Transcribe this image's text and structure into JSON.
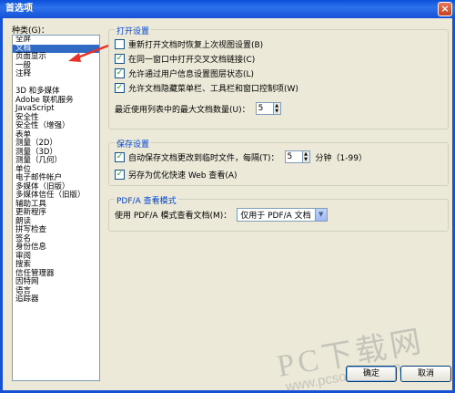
{
  "window": {
    "title": "首选项",
    "close_glyph": "×"
  },
  "categories": {
    "label": "种类(G)：",
    "top_items": [
      "全屏",
      "文档",
      "页面显示",
      "一般",
      "注释"
    ],
    "selected_index": 1,
    "items": [
      "3D 和多媒体",
      "Adobe 联机服务",
      "JavaScript",
      "安全性",
      "安全性（增强）",
      "表单",
      "测量（2D）",
      "测量（3D）",
      "测量（几何）",
      "单位",
      "电子邮件帐户",
      "多媒体（旧版）",
      "多媒体信任（旧版）",
      "辅助工具",
      "更新程序",
      "朗读",
      "拼写检查",
      "签名",
      "身份信息",
      "审阅",
      "搜索",
      "信任管理器",
      "因特网",
      "语言",
      "追踪器"
    ]
  },
  "open_settings": {
    "title": "打开设置",
    "options": [
      {
        "label": "重新打开文档时恢复上次视图设置(B)",
        "checked": false
      },
      {
        "label": "在同一窗口中打开交叉文档链接(C)",
        "checked": true
      },
      {
        "label": "允许通过用户信息设置图层状态(L)",
        "checked": true
      },
      {
        "label": "允许文档隐藏菜单栏、工具栏和窗口控制项(W)",
        "checked": true
      }
    ],
    "max_docs_label": "最近使用列表中的最大文档数量(U)：",
    "max_docs_value": "5"
  },
  "save_settings": {
    "title": "保存设置",
    "autosave_label": "自动保存文档更改到临时文件，每隔(T)：",
    "autosave_checked": true,
    "autosave_value": "5",
    "autosave_unit": "分钟（1-99）",
    "fast_web_label": "另存为优化快速 Web 查看(A)",
    "fast_web_checked": true
  },
  "pdfa": {
    "title": "PDF/A 查看模式",
    "label": "使用 PDF/A 模式查看文档(M)：",
    "selected": "仅用于 PDF/A 文档"
  },
  "buttons": {
    "ok": "确定",
    "cancel": "取消"
  },
  "watermark": {
    "line1": "PC下载网",
    "line2": "www.pcsoft.com.cn"
  },
  "colors": {
    "accent": "#316ac5",
    "group_title": "#0046d5",
    "check": "#21a121"
  }
}
